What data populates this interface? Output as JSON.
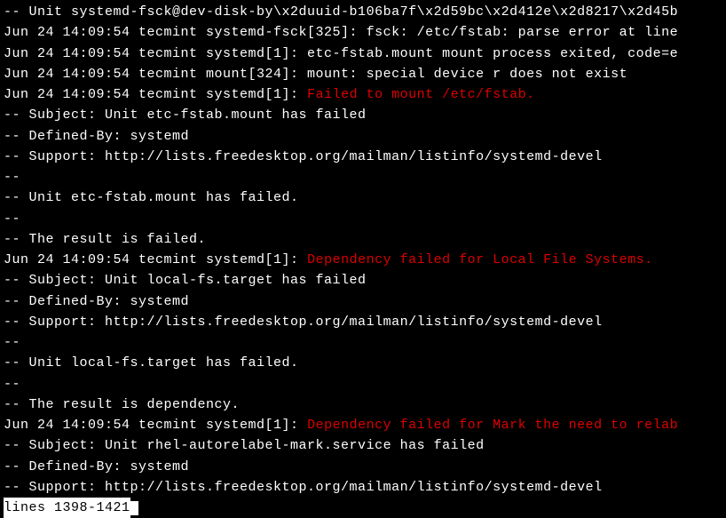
{
  "lines": [
    {
      "segments": [
        {
          "text": "-- Unit systemd-fsck@dev-disk-by\\x2duuid-b106ba7f\\x2d59bc\\x2d412e\\x2d8217\\x2d45b",
          "class": "white"
        }
      ]
    },
    {
      "segments": [
        {
          "text": "Jun 24 14:09:54 tecmint systemd-fsck[325]: fsck: /etc/fstab: parse error at line",
          "class": "white"
        }
      ]
    },
    {
      "segments": [
        {
          "text": "Jun 24 14:09:54 tecmint systemd[1]: etc-fstab.mount mount process exited, code=e",
          "class": "white"
        }
      ]
    },
    {
      "segments": [
        {
          "text": "Jun 24 14:09:54 tecmint mount[324]: mount: special device r does not exist",
          "class": "white"
        }
      ]
    },
    {
      "segments": [
        {
          "text": "Jun 24 14:09:54 tecmint systemd[1]: ",
          "class": "white"
        },
        {
          "text": "Failed to mount /etc/fstab.",
          "class": "red"
        }
      ]
    },
    {
      "segments": [
        {
          "text": "-- Subject: Unit etc-fstab.mount has failed",
          "class": "white"
        }
      ]
    },
    {
      "segments": [
        {
          "text": "-- Defined-By: systemd",
          "class": "white"
        }
      ]
    },
    {
      "segments": [
        {
          "text": "-- Support: http://lists.freedesktop.org/mailman/listinfo/systemd-devel",
          "class": "white"
        }
      ]
    },
    {
      "segments": [
        {
          "text": "--",
          "class": "white"
        }
      ]
    },
    {
      "segments": [
        {
          "text": "-- Unit etc-fstab.mount has failed.",
          "class": "white"
        }
      ]
    },
    {
      "segments": [
        {
          "text": "--",
          "class": "white"
        }
      ]
    },
    {
      "segments": [
        {
          "text": "-- The result is failed.",
          "class": "white"
        }
      ]
    },
    {
      "segments": [
        {
          "text": "Jun 24 14:09:54 tecmint systemd[1]: ",
          "class": "white"
        },
        {
          "text": "Dependency failed for Local File Systems.",
          "class": "red"
        }
      ]
    },
    {
      "segments": [
        {
          "text": "-- Subject: Unit local-fs.target has failed",
          "class": "white"
        }
      ]
    },
    {
      "segments": [
        {
          "text": "-- Defined-By: systemd",
          "class": "white"
        }
      ]
    },
    {
      "segments": [
        {
          "text": "-- Support: http://lists.freedesktop.org/mailman/listinfo/systemd-devel",
          "class": "white"
        }
      ]
    },
    {
      "segments": [
        {
          "text": "--",
          "class": "white"
        }
      ]
    },
    {
      "segments": [
        {
          "text": "-- Unit local-fs.target has failed.",
          "class": "white"
        }
      ]
    },
    {
      "segments": [
        {
          "text": "--",
          "class": "white"
        }
      ]
    },
    {
      "segments": [
        {
          "text": "-- The result is dependency.",
          "class": "white"
        }
      ]
    },
    {
      "segments": [
        {
          "text": "Jun 24 14:09:54 tecmint systemd[1]: ",
          "class": "white"
        },
        {
          "text": "Dependency failed for Mark the need to relab",
          "class": "red"
        }
      ]
    },
    {
      "segments": [
        {
          "text": "-- Subject: Unit rhel-autorelabel-mark.service has failed",
          "class": "white"
        }
      ]
    },
    {
      "segments": [
        {
          "text": "-- Defined-By: systemd",
          "class": "white"
        }
      ]
    },
    {
      "segments": [
        {
          "text": "-- Support: http://lists.freedesktop.org/mailman/listinfo/systemd-devel",
          "class": "white"
        }
      ]
    }
  ],
  "status": "lines 1398-1421"
}
